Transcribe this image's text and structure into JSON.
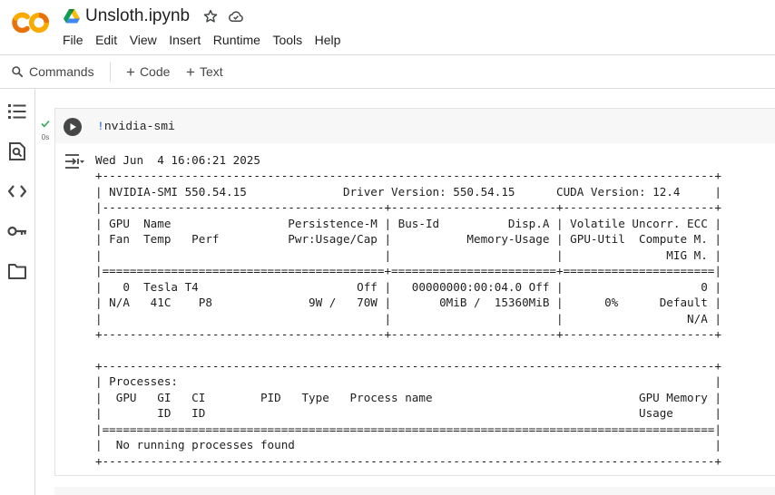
{
  "app": {
    "logo_text": "CO",
    "notebook_title": "Unsloth.ipynb",
    "icons": [
      "google-drive-icon",
      "star-icon",
      "cloud-saved-icon"
    ]
  },
  "menu": [
    "File",
    "Edit",
    "View",
    "Insert",
    "Runtime",
    "Tools",
    "Help"
  ],
  "toolbar": {
    "commands_label": "Commands",
    "code_label": "Code",
    "text_label": "Text"
  },
  "rail_icons": [
    "table-of-contents-icon",
    "find-icon",
    "code-snippets-icon",
    "secrets-key-icon",
    "files-folder-icon"
  ],
  "cell": {
    "exec_time": "0s",
    "code_prefix": "!",
    "code_body": "nvidia-smi",
    "output_lines": [
      "Wed Jun  4 16:06:21 2025",
      "+-----------------------------------------------------------------------------------------+",
      "| NVIDIA-SMI 550.54.15              Driver Version: 550.54.15      CUDA Version: 12.4     |",
      "|-----------------------------------------+------------------------+----------------------+",
      "| GPU  Name                 Persistence-M | Bus-Id          Disp.A | Volatile Uncorr. ECC |",
      "| Fan  Temp   Perf          Pwr:Usage/Cap |           Memory-Usage | GPU-Util  Compute M. |",
      "|                                         |                        |               MIG M. |",
      "|=========================================+========================+======================|",
      "|   0  Tesla T4                       Off |   00000000:00:04.0 Off |                    0 |",
      "| N/A   41C    P8              9W /   70W |       0MiB /  15360MiB |      0%      Default |",
      "|                                         |                        |                  N/A |",
      "+-----------------------------------------+------------------------+----------------------+",
      "",
      "+-----------------------------------------------------------------------------------------+",
      "| Processes:                                                                              |",
      "|  GPU   GI   CI        PID   Type   Process name                              GPU Memory |",
      "|        ID   ID                                                               Usage      |",
      "|=========================================================================================|",
      "|  No running processes found                                                             |",
      "+-----------------------------------------------------------------------------------------+"
    ]
  },
  "colors": {
    "logo_orange": "#F9AB00",
    "logo_orange_dark": "#E8710A",
    "run_button": "#444746",
    "success_check": "#34a853",
    "bang": "#0b57d0"
  }
}
